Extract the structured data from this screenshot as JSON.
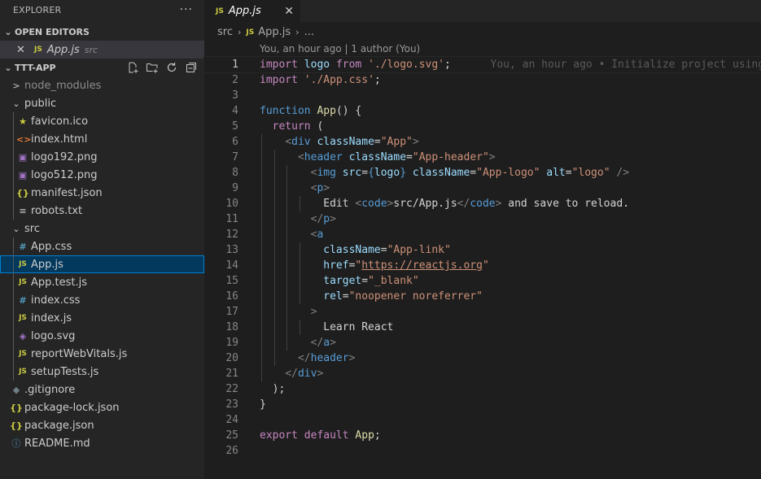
{
  "explorer": {
    "title": "EXPLORER",
    "more": "···",
    "open_editors": {
      "label": "OPEN EDITORS",
      "items": [
        {
          "close": "✕",
          "badge": "JS",
          "name": "App.js",
          "dir": "src"
        }
      ]
    },
    "project": {
      "label": "TTT-APP",
      "tree": [
        {
          "name": "node_modules",
          "icon": ">",
          "kind": "folder-collapsed",
          "depth": 1,
          "muted": true
        },
        {
          "name": "public",
          "icon": "⌄",
          "kind": "folder-open",
          "depth": 1
        },
        {
          "name": "favicon.ico",
          "icon": "★",
          "kind": "star",
          "depth": 2
        },
        {
          "name": "index.html",
          "icon": "<>",
          "kind": "html",
          "depth": 2
        },
        {
          "name": "logo192.png",
          "icon": "▣",
          "kind": "png",
          "depth": 2
        },
        {
          "name": "logo512.png",
          "icon": "▣",
          "kind": "png",
          "depth": 2
        },
        {
          "name": "manifest.json",
          "icon": "{}",
          "kind": "json",
          "depth": 2
        },
        {
          "name": "robots.txt",
          "icon": "≡",
          "kind": "txt",
          "depth": 2
        },
        {
          "name": "src",
          "icon": "⌄",
          "kind": "folder-open",
          "depth": 1
        },
        {
          "name": "App.css",
          "icon": "#",
          "kind": "css",
          "depth": 2
        },
        {
          "name": "App.js",
          "icon": "JS",
          "kind": "js",
          "depth": 2,
          "selected": true
        },
        {
          "name": "App.test.js",
          "icon": "JS",
          "kind": "js",
          "depth": 2
        },
        {
          "name": "index.css",
          "icon": "#",
          "kind": "css",
          "depth": 2
        },
        {
          "name": "index.js",
          "icon": "JS",
          "kind": "js",
          "depth": 2
        },
        {
          "name": "logo.svg",
          "icon": "◈",
          "kind": "png",
          "depth": 2
        },
        {
          "name": "reportWebVitals.js",
          "icon": "JS",
          "kind": "js",
          "depth": 2
        },
        {
          "name": "setupTests.js",
          "icon": "JS",
          "kind": "js",
          "depth": 2
        },
        {
          "name": ".gitignore",
          "icon": "◆",
          "kind": "git",
          "depth": 1,
          "muted": false
        },
        {
          "name": "package-lock.json",
          "icon": "{}",
          "kind": "json",
          "depth": 1
        },
        {
          "name": "package.json",
          "icon": "{}",
          "kind": "json",
          "depth": 1
        },
        {
          "name": "README.md",
          "icon": "ⓘ",
          "kind": "info",
          "depth": 1
        }
      ]
    }
  },
  "editor": {
    "tab": {
      "badge": "JS",
      "name": "App.js",
      "close": "✕"
    },
    "breadcrumb": {
      "folder": "src",
      "file": "App.js",
      "more": "..."
    },
    "codelens": "You, an hour ago | 1 author (You)",
    "blame": "You, an hour ago • Initialize project using",
    "active_line": 1,
    "lines": [
      [
        [
          "k",
          "import"
        ],
        [
          "p",
          " "
        ],
        [
          "v",
          "logo"
        ],
        [
          "p",
          " "
        ],
        [
          "k",
          "from"
        ],
        [
          "p",
          " "
        ],
        [
          "s",
          "'./logo.svg'"
        ],
        [
          "p",
          ";"
        ]
      ],
      [
        [
          "k",
          "import"
        ],
        [
          "p",
          " "
        ],
        [
          "s",
          "'./App.css'"
        ],
        [
          "p",
          ";"
        ]
      ],
      [],
      [
        [
          "kb",
          "function"
        ],
        [
          "p",
          " "
        ],
        [
          "f",
          "App"
        ],
        [
          "p",
          "() {"
        ]
      ],
      [
        [
          "p",
          "  "
        ],
        [
          "k",
          "return"
        ],
        [
          "p",
          " ("
        ]
      ],
      [
        [
          "p",
          "    "
        ],
        [
          "tg",
          "<"
        ],
        [
          "t",
          "div"
        ],
        [
          "p",
          " "
        ],
        [
          "v",
          "className"
        ],
        [
          "p",
          "="
        ],
        [
          "s",
          "\"App\""
        ],
        [
          "tg",
          ">"
        ]
      ],
      [
        [
          "p",
          "      "
        ],
        [
          "tg",
          "<"
        ],
        [
          "t",
          "header"
        ],
        [
          "p",
          " "
        ],
        [
          "v",
          "className"
        ],
        [
          "p",
          "="
        ],
        [
          "s",
          "\"App-header\""
        ],
        [
          "tg",
          ">"
        ]
      ],
      [
        [
          "p",
          "        "
        ],
        [
          "tg",
          "<"
        ],
        [
          "t",
          "img"
        ],
        [
          "p",
          " "
        ],
        [
          "v",
          "src"
        ],
        [
          "p",
          "="
        ],
        [
          "kb",
          "{"
        ],
        [
          "v",
          "logo"
        ],
        [
          "kb",
          "}"
        ],
        [
          "p",
          " "
        ],
        [
          "v",
          "className"
        ],
        [
          "p",
          "="
        ],
        [
          "s",
          "\"App-logo\""
        ],
        [
          "p",
          " "
        ],
        [
          "v",
          "alt"
        ],
        [
          "p",
          "="
        ],
        [
          "s",
          "\"logo\""
        ],
        [
          "p",
          " "
        ],
        [
          "tg",
          "/>"
        ]
      ],
      [
        [
          "p",
          "        "
        ],
        [
          "tg",
          "<"
        ],
        [
          "t",
          "p"
        ],
        [
          "tg",
          ">"
        ]
      ],
      [
        [
          "p",
          "          Edit "
        ],
        [
          "tg",
          "<"
        ],
        [
          "t",
          "code"
        ],
        [
          "tg",
          ">"
        ],
        [
          "p",
          "src/App.js"
        ],
        [
          "tg",
          "</"
        ],
        [
          "t",
          "code"
        ],
        [
          "tg",
          ">"
        ],
        [
          "p",
          " and save to reload."
        ]
      ],
      [
        [
          "p",
          "        "
        ],
        [
          "tg",
          "</"
        ],
        [
          "t",
          "p"
        ],
        [
          "tg",
          ">"
        ]
      ],
      [
        [
          "p",
          "        "
        ],
        [
          "tg",
          "<"
        ],
        [
          "t",
          "a"
        ]
      ],
      [
        [
          "p",
          "          "
        ],
        [
          "v",
          "className"
        ],
        [
          "p",
          "="
        ],
        [
          "s",
          "\"App-link\""
        ]
      ],
      [
        [
          "p",
          "          "
        ],
        [
          "v",
          "href"
        ],
        [
          "p",
          "="
        ],
        [
          "s",
          "\""
        ],
        [
          "u",
          "https://reactjs.org"
        ],
        [
          "s",
          "\""
        ]
      ],
      [
        [
          "p",
          "          "
        ],
        [
          "v",
          "target"
        ],
        [
          "p",
          "="
        ],
        [
          "s",
          "\"_blank\""
        ]
      ],
      [
        [
          "p",
          "          "
        ],
        [
          "v",
          "rel"
        ],
        [
          "p",
          "="
        ],
        [
          "s",
          "\"noopener noreferrer\""
        ]
      ],
      [
        [
          "p",
          "        "
        ],
        [
          "tg",
          ">"
        ]
      ],
      [
        [
          "p",
          "          Learn React"
        ]
      ],
      [
        [
          "p",
          "        "
        ],
        [
          "tg",
          "</"
        ],
        [
          "t",
          "a"
        ],
        [
          "tg",
          ">"
        ]
      ],
      [
        [
          "p",
          "      "
        ],
        [
          "tg",
          "</"
        ],
        [
          "t",
          "header"
        ],
        [
          "tg",
          ">"
        ]
      ],
      [
        [
          "p",
          "    "
        ],
        [
          "tg",
          "</"
        ],
        [
          "t",
          "div"
        ],
        [
          "tg",
          ">"
        ]
      ],
      [
        [
          "p",
          "  );"
        ]
      ],
      [
        [
          "p",
          "}"
        ]
      ],
      [],
      [
        [
          "k",
          "export"
        ],
        [
          "p",
          " "
        ],
        [
          "k",
          "default"
        ],
        [
          "p",
          " "
        ],
        [
          "f",
          "App"
        ],
        [
          "p",
          ";"
        ]
      ],
      []
    ]
  }
}
